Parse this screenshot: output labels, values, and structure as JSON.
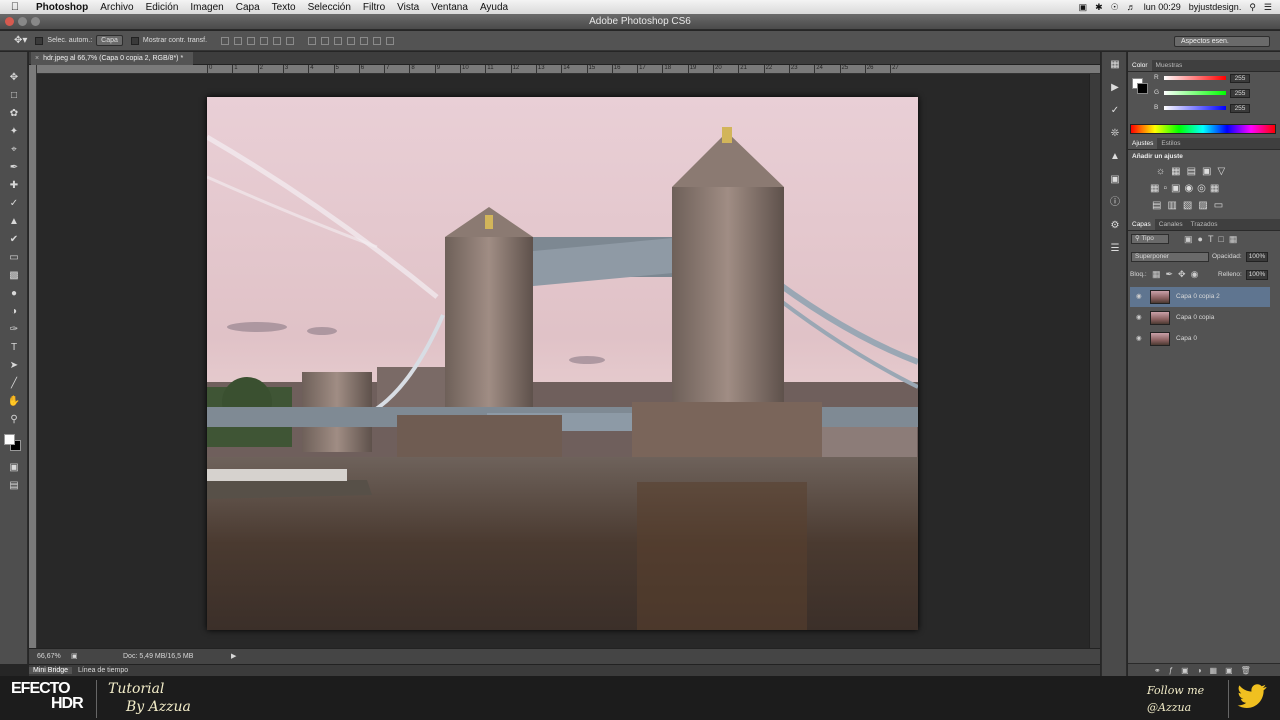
{
  "menubar": {
    "app": "Photoshop",
    "items": [
      "Archivo",
      "Edición",
      "Imagen",
      "Capa",
      "Texto",
      "Selección",
      "Filtro",
      "Vista",
      "Ventana",
      "Ayuda"
    ],
    "clock": "lun 00:29",
    "user": "byjustdesign."
  },
  "window": {
    "title": "Adobe Photoshop CS6"
  },
  "options": {
    "auto_select": "Selec. autom.:",
    "auto_select_target": "Capa",
    "transform_controls": "Mostrar contr. transf.",
    "workspace": "Aspectos esen."
  },
  "document": {
    "tab": "hdr.jpeg al 66,7% (Capa 0 copia 2, RGB/8*) *",
    "ruler_labels": [
      "0",
      "1",
      "2",
      "3",
      "4",
      "5",
      "6",
      "7",
      "8",
      "9",
      "10",
      "11",
      "12",
      "13",
      "14",
      "15",
      "16",
      "17",
      "18",
      "19",
      "20",
      "21",
      "22",
      "23",
      "24",
      "25",
      "26",
      "27"
    ]
  },
  "status": {
    "zoom": "66,67%",
    "doc": "Doc: 5,49 MB/16,5 MB"
  },
  "bottom_tabs": [
    "Mini Bridge",
    "Línea de tiempo"
  ],
  "color_panel": {
    "tabs": [
      "Color",
      "Muestras"
    ],
    "channels": [
      {
        "label": "R",
        "value": "255",
        "color": "#ff0000"
      },
      {
        "label": "G",
        "value": "255",
        "color": "#00ff00"
      },
      {
        "label": "B",
        "value": "255",
        "color": "#0000ff"
      }
    ]
  },
  "adjust_panel": {
    "tabs": [
      "Ajustes",
      "Estilos"
    ],
    "heading": "Añadir un ajuste"
  },
  "layers_panel": {
    "tabs": [
      "Capas",
      "Canales",
      "Trazados"
    ],
    "kind": "Tipo",
    "blend": "Superponer",
    "opacity_label": "Opacidad:",
    "opacity": "100%",
    "lock_label": "Bloq.:",
    "fill_label": "Relleno:",
    "fill": "100%",
    "layers": [
      {
        "name": "Capa 0 copia 2",
        "selected": true
      },
      {
        "name": "Capa 0 copia",
        "selected": false
      },
      {
        "name": "Capa 0",
        "selected": false
      }
    ]
  },
  "overlay": {
    "brand_line1": "EFECTO",
    "brand_line2": "HDR",
    "tutorial_line1": "Tutorial",
    "tutorial_line2": "By Azzua",
    "follow_line1": "Follow me",
    "follow_line2": "@Azzua"
  },
  "colors": {
    "accent_layer": "#5f7590",
    "ui_bg": "#535353",
    "canvas": "#282828"
  }
}
